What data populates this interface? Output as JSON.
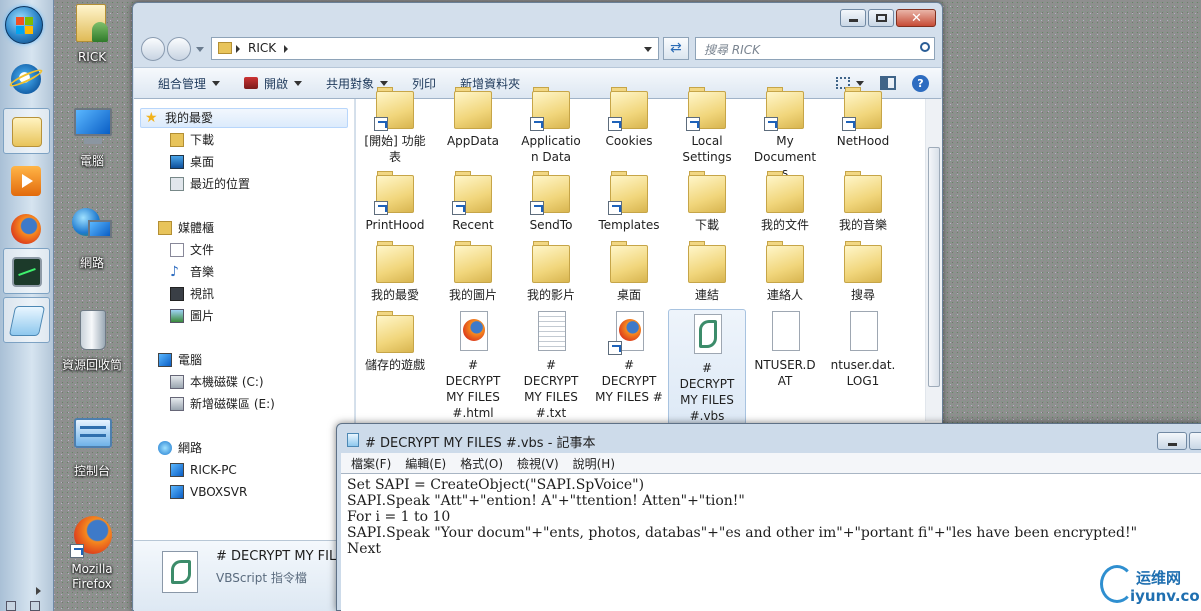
{
  "desktop": {
    "icons": [
      {
        "label": "RICK",
        "icon": "user-folder-icon"
      },
      {
        "label": "電腦",
        "icon": "computer-icon"
      },
      {
        "label": "網路",
        "icon": "network-icon"
      },
      {
        "label": "資源回收筒",
        "icon": "recycle-bin-icon"
      },
      {
        "label": "控制台",
        "icon": "control-panel-icon"
      },
      {
        "label": "Mozilla\nFirefox",
        "icon": "firefox-icon"
      }
    ]
  },
  "taskbar": {
    "items": [
      "start-orb",
      "internet-explorer",
      "windows-explorer",
      "media-player",
      "firefox",
      "task-manager",
      "notepad"
    ]
  },
  "explorer": {
    "breadcrumb": "RICK",
    "search_placeholder": "搜尋 RICK",
    "toolbar": {
      "organize": "組合管理",
      "open": "開啟",
      "share": "共用對象",
      "print": "列印",
      "new_folder": "新增資料夾"
    },
    "nav": {
      "favorites": "我的最愛",
      "downloads": "下載",
      "desktop": "桌面",
      "recent": "最近的位置",
      "libraries": "媒體櫃",
      "documents": "文件",
      "music": "音樂",
      "videos": "視訊",
      "pictures": "圖片",
      "computer": "電腦",
      "drive_c": "本機磁碟 (C:)",
      "drive_e": "新增磁碟區 (E:)",
      "network": "網路",
      "rick_pc": "RICK-PC",
      "vboxsvr": "VBOXSVR"
    },
    "files": [
      {
        "name": "[開始] 功能\n表",
        "type": "folder-shortcut"
      },
      {
        "name": "AppData",
        "type": "folder"
      },
      {
        "name": "Applicatio\nn Data",
        "type": "folder-shortcut"
      },
      {
        "name": "Cookies",
        "type": "folder-shortcut"
      },
      {
        "name": "Local\nSettings",
        "type": "folder-shortcut"
      },
      {
        "name": "My\nDocument\ns",
        "type": "folder-shortcut"
      },
      {
        "name": "NetHood",
        "type": "folder-shortcut"
      },
      {
        "name": "PrintHood",
        "type": "folder-shortcut"
      },
      {
        "name": "Recent",
        "type": "folder-shortcut"
      },
      {
        "name": "SendTo",
        "type": "folder-shortcut"
      },
      {
        "name": "Templates",
        "type": "folder-shortcut"
      },
      {
        "name": "下載",
        "type": "folder"
      },
      {
        "name": "我的文件",
        "type": "folder"
      },
      {
        "name": "我的音樂",
        "type": "folder"
      },
      {
        "name": "我的最愛",
        "type": "folder"
      },
      {
        "name": "我的圖片",
        "type": "folder"
      },
      {
        "name": "我的影片",
        "type": "folder"
      },
      {
        "name": "桌面",
        "type": "folder"
      },
      {
        "name": "連結",
        "type": "folder"
      },
      {
        "name": "連絡人",
        "type": "folder"
      },
      {
        "name": "搜尋",
        "type": "folder"
      },
      {
        "name": "儲存的遊戲",
        "type": "folder"
      },
      {
        "name": "#\nDECRYPT\nMY FILES\n#.html",
        "type": "html"
      },
      {
        "name": "#\nDECRYPT\nMY FILES\n#.txt",
        "type": "txt"
      },
      {
        "name": "#\nDECRYPT\nMY FILES #",
        "type": "html-shortcut"
      },
      {
        "name": "#\nDECRYPT\nMY FILES\n#.vbs",
        "type": "vbs"
      },
      {
        "name": "NTUSER.D\nAT",
        "type": "file"
      },
      {
        "name": "ntuser.dat.\nLOG1",
        "type": "file"
      }
    ],
    "details": {
      "name": "# DECRYPT MY FILES #",
      "type": "VBScript 指令檔"
    }
  },
  "notepad": {
    "title": "# DECRYPT MY FILES #.vbs - 記事本",
    "menu": [
      "檔案(F)",
      "編輯(E)",
      "格式(O)",
      "檢視(V)",
      "說明(H)"
    ],
    "content": "Set SAPI = CreateObject(\"SAPI.SpVoice\")\nSAPI.Speak \"Att\"+\"ention! A\"+\"ttention! Atten\"+\"tion!\"\nFor i = 1 to 10\nSAPI.Speak \"Your docum\"+\"ents, photos, databas\"+\"es and other im\"+\"portant fi\"+\"les have been encrypted!\"\nNext"
  },
  "watermark": {
    "text": "运维网",
    "url": "iyunv.com"
  }
}
